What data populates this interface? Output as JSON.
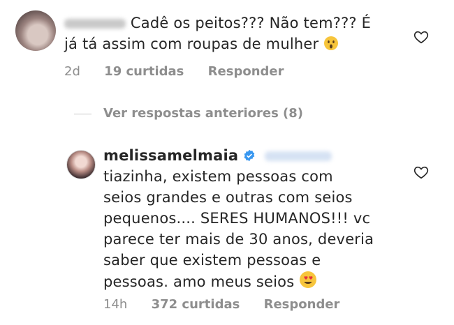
{
  "comment1": {
    "username": "silmeira",
    "text_line1": "Cadê os peitos??? Não tem??? É",
    "text_line2": "já tá assim com roupas de mulher",
    "emoji": "astonished-face-emoji",
    "time": "2d",
    "likes": "19 curtidas",
    "reply": "Responder"
  },
  "view_previous": "Ver respostas anteriores (8)",
  "reply1": {
    "username": "melissamelmaia",
    "mention": "@silmeira",
    "lines": [
      "tiazinha, existem pessoas com",
      "seios grandes e outras com seios",
      "pequenos.... SERES HUMANOS!!! vc",
      "parece ter mais de 30 anos, deveria",
      "saber que existem pessoas e",
      "pessoas. amo meus seios"
    ],
    "emoji": "heart-eyes-emoji",
    "time": "14h",
    "likes": "372 curtidas",
    "reply": "Responder"
  },
  "icons": {
    "like": "heart-outline-icon",
    "verified": "verified-badge-icon"
  }
}
